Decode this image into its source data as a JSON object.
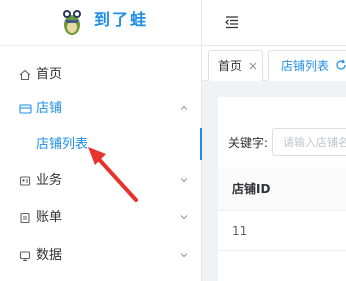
{
  "app": {
    "name": "到了蛙"
  },
  "sidebar": {
    "items": [
      {
        "label": "首页",
        "icon": "home-icon"
      },
      {
        "label": "店铺",
        "icon": "shop-icon",
        "expanded": true
      },
      {
        "label": "业务",
        "icon": "business-icon"
      },
      {
        "label": "账单",
        "icon": "bill-icon"
      },
      {
        "label": "数据",
        "icon": "data-icon"
      }
    ],
    "submenu": {
      "label": "店铺列表"
    }
  },
  "tabs": [
    {
      "label": "首页",
      "close": "×"
    },
    {
      "label": "店铺列表"
    }
  ],
  "filter": {
    "label": "关键字:",
    "placeholder": "请输入店铺名"
  },
  "table": {
    "columns": [
      "店铺ID"
    ],
    "rows": [
      [
        "11"
      ]
    ]
  },
  "colors": {
    "accent": "#1e8fe6",
    "annotation": "#e8322c"
  }
}
